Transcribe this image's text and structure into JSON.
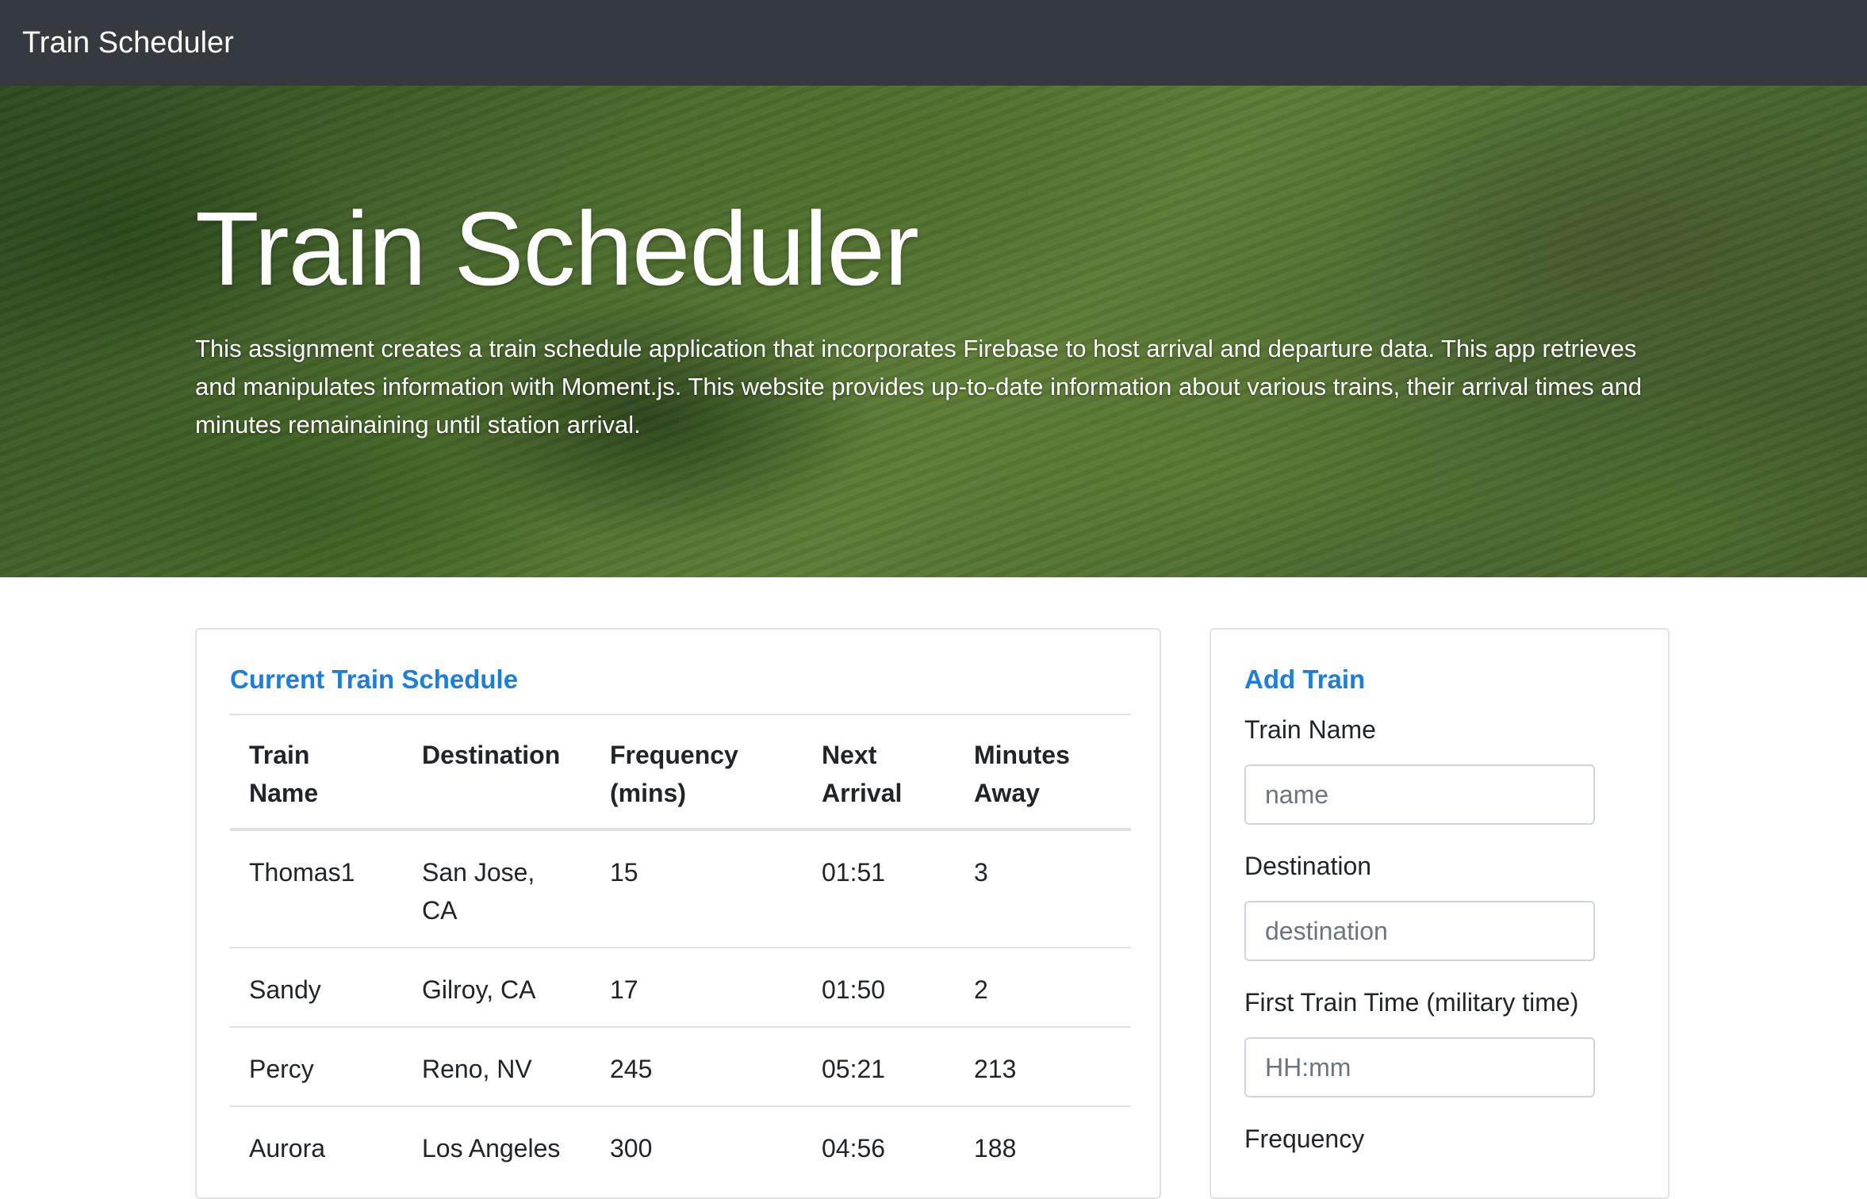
{
  "navbar": {
    "brand": "Train Scheduler"
  },
  "jumbotron": {
    "title": "Train Scheduler",
    "description": "This assignment creates a train schedule application that incorporates Firebase to host arrival and departure data. This app retrieves and manipulates information with Moment.js. This website provides up-to-date information about various trains, their arrival times and minutes remainaining until station arrival."
  },
  "schedule": {
    "title": "Current Train Schedule",
    "columns": [
      "Train Name",
      "Destination",
      "Frequency (mins)",
      "Next Arrival",
      "Minutes Away"
    ],
    "rows": [
      [
        "Thomas1",
        "San Jose, CA",
        "15",
        "01:51",
        "3"
      ],
      [
        "Sandy",
        "Gilroy, CA",
        "17",
        "01:50",
        "2"
      ],
      [
        "Percy",
        "Reno, NV",
        "245",
        "05:21",
        "213"
      ],
      [
        "Aurora",
        "Los Angeles",
        "300",
        "04:56",
        "188"
      ]
    ]
  },
  "add_train": {
    "title": "Add Train",
    "fields": [
      {
        "label": "Train Name",
        "placeholder": "name"
      },
      {
        "label": "Destination",
        "placeholder": "destination"
      },
      {
        "label": "First Train Time (military time)",
        "placeholder": "HH:mm"
      },
      {
        "label": "Frequency",
        "placeholder": ""
      }
    ]
  }
}
